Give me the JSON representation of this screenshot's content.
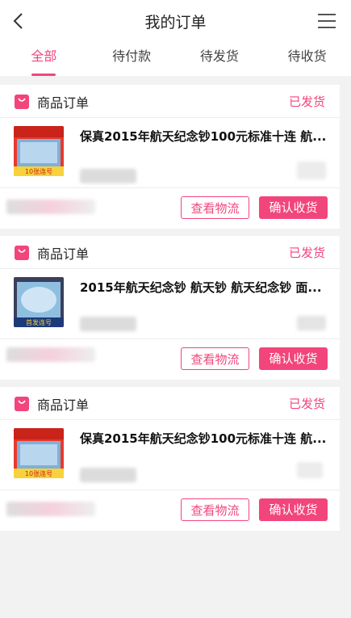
{
  "header": {
    "title": "我的订单"
  },
  "tabs": [
    {
      "label": "全部",
      "active": true
    },
    {
      "label": "待付款",
      "active": false
    },
    {
      "label": "待发货",
      "active": false
    },
    {
      "label": "待收货",
      "active": false
    }
  ],
  "orders": [
    {
      "shop_label": "商品订单",
      "status": "已发货",
      "product_name": "保真2015年航天纪念钞100元标准十连 航...",
      "thumb_caption": "10张连号",
      "logistics_label": "查看物流",
      "confirm_label": "确认收货"
    },
    {
      "shop_label": "商品订单",
      "status": "已发货",
      "product_name": "2015年航天纪念钞 航天钞 航天纪念钞 面...",
      "thumb_caption": "首发连号",
      "logistics_label": "查看物流",
      "confirm_label": "确认收货"
    },
    {
      "shop_label": "商品订单",
      "status": "已发货",
      "product_name": "保真2015年航天纪念钞100元标准十连 航...",
      "thumb_caption": "10张连号",
      "logistics_label": "查看物流",
      "confirm_label": "确认收货"
    }
  ],
  "colors": {
    "accent": "#f2457c",
    "background": "#f2f2f2"
  }
}
